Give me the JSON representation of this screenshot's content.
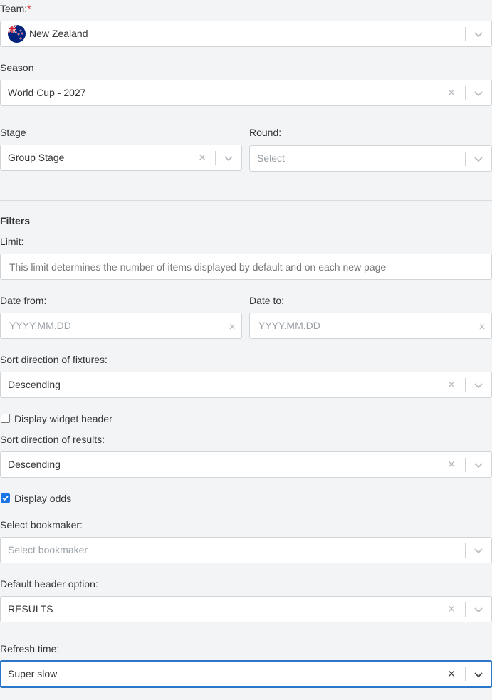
{
  "team": {
    "label": "Team:",
    "required_mark": "*",
    "value": "New Zealand",
    "flag_icon": "new-zealand-flag-icon"
  },
  "season": {
    "label": "Season",
    "value": "World Cup - 2027"
  },
  "stage": {
    "label": "Stage",
    "value": "Group Stage"
  },
  "round": {
    "label": "Round:",
    "placeholder": "Select"
  },
  "filters": {
    "heading": "Filters"
  },
  "limit": {
    "label": "Limit:",
    "placeholder": "This limit determines the number of items displayed by default and on each new page"
  },
  "date_from": {
    "label": "Date from:",
    "placeholder": "YYYY.MM.DD"
  },
  "date_to": {
    "label": "Date to:",
    "placeholder": "YYYY.MM.DD"
  },
  "sort_fixtures": {
    "label": "Sort direction of fixtures:",
    "value": "Descending"
  },
  "widget_header": {
    "label": "Display widget header",
    "checked": false
  },
  "sort_results": {
    "label": "Sort direction of results:",
    "value": "Descending"
  },
  "display_odds": {
    "label": "Display odds",
    "checked": true
  },
  "bookmaker": {
    "label": "Select bookmaker:",
    "placeholder": "Select bookmaker"
  },
  "default_header": {
    "label": "Default header option:",
    "value": "RESULTS"
  },
  "refresh_time": {
    "label": "Refresh time:",
    "value": "Super slow"
  },
  "icons": {
    "clear": "×",
    "accent": "#2a77c9",
    "checkbox_on": "#1a73e8"
  }
}
